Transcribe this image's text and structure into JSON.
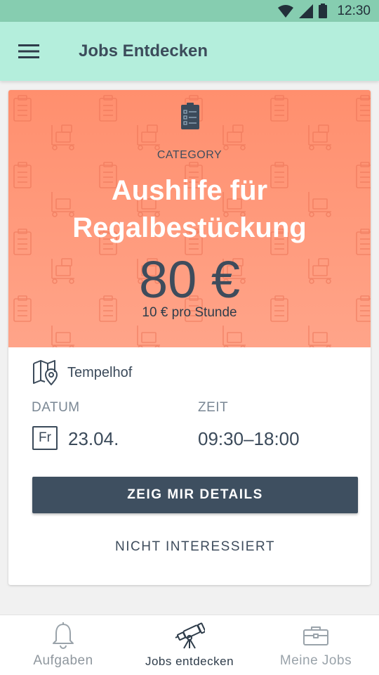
{
  "status_bar": {
    "time": "12:30",
    "icons": [
      "wifi-icon",
      "signal-icon",
      "battery-icon"
    ]
  },
  "app_bar": {
    "menu_icon": "hamburger-menu-icon",
    "title": "Jobs Entdecken"
  },
  "job_card": {
    "category_icon": "clipboard-icon",
    "category": "CATEGORY",
    "title": "Aushilfe für Regalbestückung",
    "title_line1": "Aushilfe für",
    "title_line2": "Regalbestückung",
    "price": "80 €",
    "rate": "10 € pro Stunde",
    "location_icon": "map-pin-icon",
    "location": "Tempelhof",
    "date_label": "DATUM",
    "time_label": "ZEIT",
    "weekday": "Fr",
    "date": "23.04.",
    "time": "09:30–18:00",
    "details_button": "ZEIG MIR DETAILS",
    "not_interested_button": "NICHT INTERESSIERT"
  },
  "bottom_nav": {
    "items": [
      {
        "label": "Aufgaben",
        "icon": "bell-icon",
        "active": false
      },
      {
        "label": "Jobs entdecken",
        "icon": "telescope-icon",
        "active": true
      },
      {
        "label": "Meine Jobs",
        "icon": "briefcase-icon",
        "active": false
      }
    ]
  },
  "colors": {
    "status_bar": "#86cdb0",
    "app_bar": "#b4eedc",
    "hero": "#ff9a7d",
    "primary_button": "#3e4f60",
    "text_dark": "#3b4a5a"
  }
}
